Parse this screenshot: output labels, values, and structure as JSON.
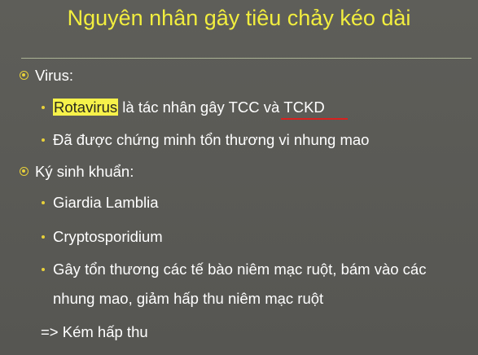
{
  "slide": {
    "title": "Nguyên nhân gây tiêu chảy kéo dài",
    "colors": {
      "background": "#595955",
      "title": "#f2ee3e",
      "bullet": "#e8d13a",
      "highlight": "#f6f24a",
      "underline": "#d8211f"
    },
    "virus": {
      "heading": "Virus:",
      "rotavirus": "Rotavirus",
      "line1_rest": " là tác nhân gây TCC và ",
      "tckd": "TCKD",
      "line2": "Đã được chứng minh tổn thương vi nhung mao"
    },
    "parasite": {
      "heading": "Ký sinh khuẩn:",
      "item1": "Giardia Lamblia",
      "item2": "Cryptosporidium",
      "item3_line1": "Gây tổn thương các tế bào niêm mạc ruột, bám vào các",
      "item3_line2": "nhung mao, giảm hấp thu niêm mạc ruột",
      "conclusion": "=> Kém hấp thu"
    }
  }
}
